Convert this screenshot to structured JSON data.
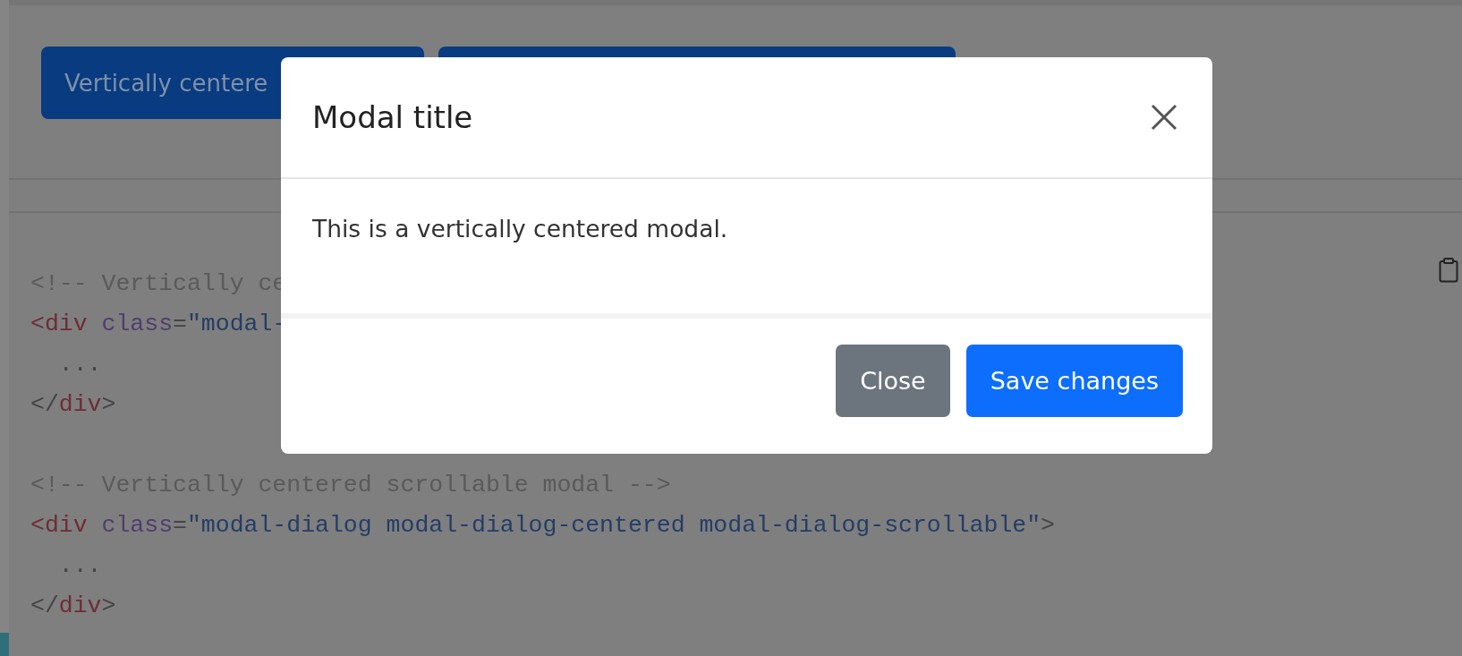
{
  "page_buttons": [
    {
      "kind": "labeled",
      "label": "Vertically centere"
    },
    {
      "kind": "covered"
    }
  ],
  "code_blocks": [
    {
      "lines": [
        {
          "tokens": [
            {
              "kind": "comment",
              "text": "<!-- Vertically ce"
            }
          ]
        },
        {
          "tokens": [
            {
              "kind": "tag",
              "text": "<div "
            },
            {
              "kind": "attr",
              "text": "class"
            },
            {
              "kind": "plain",
              "text": "="
            },
            {
              "kind": "string",
              "text": "\"modal-"
            }
          ]
        },
        {
          "tokens": [
            {
              "kind": "plain",
              "text": "  ..."
            }
          ]
        },
        {
          "tokens": [
            {
              "kind": "plain",
              "text": "</"
            },
            {
              "kind": "tag",
              "text": "div"
            },
            {
              "kind": "plain",
              "text": ">"
            }
          ]
        }
      ]
    },
    {
      "lines": [
        {
          "tokens": [
            {
              "kind": "comment",
              "text": "<!-- Vertically centered scrollable modal -->"
            }
          ]
        },
        {
          "tokens": [
            {
              "kind": "tag",
              "text": "<div "
            },
            {
              "kind": "attr",
              "text": "class"
            },
            {
              "kind": "plain",
              "text": "="
            },
            {
              "kind": "string",
              "text": "\"modal-dialog modal-dialog-centered modal-dialog-scrollable\""
            },
            {
              "kind": "plain",
              "text": ">"
            }
          ]
        },
        {
          "tokens": [
            {
              "kind": "plain",
              "text": "  ..."
            }
          ]
        },
        {
          "tokens": [
            {
              "kind": "plain",
              "text": "</"
            },
            {
              "kind": "tag",
              "text": "div"
            },
            {
              "kind": "plain",
              "text": ">"
            }
          ]
        }
      ]
    }
  ],
  "modal": {
    "title": "Modal title",
    "body": "This is a vertically centered modal.",
    "buttons": [
      {
        "label": "Close",
        "kind": "secondary"
      },
      {
        "label": "Save changes",
        "kind": "primary"
      }
    ]
  }
}
